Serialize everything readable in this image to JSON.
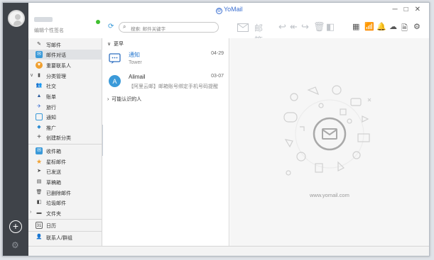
{
  "app": {
    "name": "YoMail"
  },
  "profile": {
    "signature": "编辑个性签名"
  },
  "search": {
    "placeholder": "搜索: 邮件关键字"
  },
  "toolbar": {
    "mail_label": "邮箱"
  },
  "nav": {
    "compose": "写邮件",
    "mail_conversation": "邮件对话",
    "important_contacts": "重要联系人",
    "category_manage": "分类管理",
    "categories": [
      "社交",
      "账单",
      "旅行",
      "通知",
      "推广"
    ],
    "new_category": "创建新分类",
    "folders": [
      "收件箱",
      "星标邮件",
      "已发送",
      "草稿箱",
      "已删除邮件",
      "垃圾邮件",
      "文件夹"
    ],
    "calendar": "日历",
    "contacts": "联系人/群组"
  },
  "mail_list": {
    "group_title": "更早",
    "items": [
      {
        "sender": "通知",
        "date": "04-29",
        "preview": "Tower"
      },
      {
        "sender": "Alimail",
        "date": "03-07",
        "preview": "【阿里云邮】邮箱账号绑定手机号码提醒"
      }
    ],
    "known_people": "可能认识的人"
  },
  "preview": {
    "url": "www.yomail.com"
  },
  "colors": {
    "accent": "#3b9ad9",
    "sidebar": "#3f4349",
    "brand": "#3b6fd1"
  }
}
